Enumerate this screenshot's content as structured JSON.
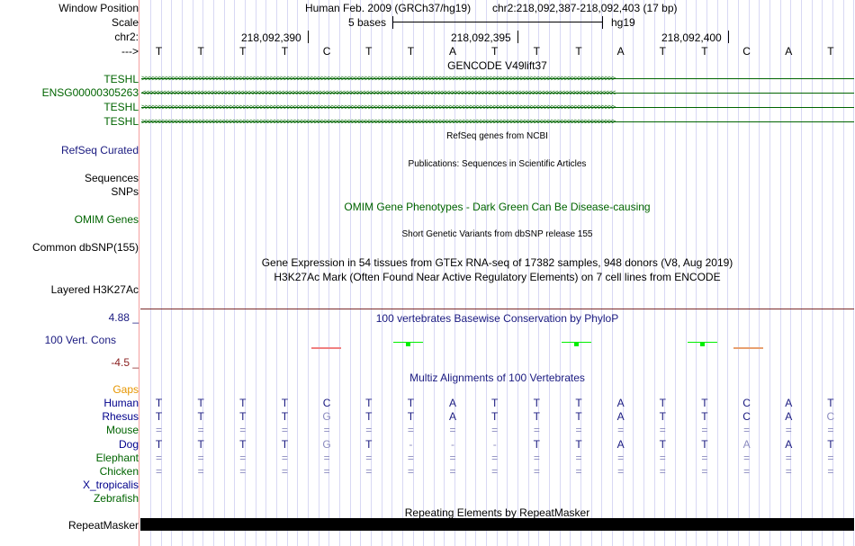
{
  "labels": {
    "window_position": "Window Position",
    "scale": "Scale",
    "chr": "chr2:",
    "strand": "--->",
    "teshl": "TESHL",
    "ensg": "ENSG00000305263",
    "refseq": "RefSeq Curated",
    "sequences": "Sequences",
    "snps": "SNPs",
    "omim": "OMIM Genes",
    "dbsnp": "Common dbSNP(155)",
    "h3k27ac": "Layered H3K27Ac",
    "cons_max": "4.88 _",
    "cons_label": "100 Vert. Cons",
    "cons_min": "-4.5 _",
    "gaps": "Gaps",
    "repeatmasker": "RepeatMasker"
  },
  "header": {
    "assembly": "Human Feb. 2009 (GRCh37/hg19)",
    "position": "chr2:218,092,387-218,092,403 (17 bp)",
    "scale_text": "5 bases",
    "scale_db": "hg19",
    "coord1": "218,092,390",
    "coord2": "218,092,395",
    "coord3": "218,092,400"
  },
  "track_titles": {
    "gencode": "GENCODE V49lift37",
    "refseq": "RefSeq genes from NCBI",
    "publications": "Publications: Sequences in Scientific Articles",
    "omim": "OMIM Gene Phenotypes - Dark Green Can Be Disease-causing",
    "dbsnp": "Short Genetic Variants from dbSNP release 155",
    "gtex": "Gene Expression in 54 tissues from GTEx RNA-seq of 17382 samples, 948 donors (V8, Aug 2019)",
    "h3k27ac": "H3K27Ac Mark (Often Found Near Active Regulatory Elements) on 7 cell lines from ENCODE",
    "phylop": "100 vertebrates Basewise Conservation by PhyloP",
    "multiz": "Multiz Alignments of 100 Vertebrates",
    "repeatmasker": "Repeating Elements by RepeatMasker"
  },
  "sequence": [
    "T",
    "T",
    "T",
    "T",
    "C",
    "T",
    "T",
    "A",
    "T",
    "T",
    "T",
    "A",
    "T",
    "T",
    "C",
    "A",
    "T"
  ],
  "alignment": [
    {
      "species": "Human",
      "bases": [
        "T",
        "T",
        "T",
        "T",
        "C",
        "T",
        "T",
        "A",
        "T",
        "T",
        "T",
        "A",
        "T",
        "T",
        "C",
        "A",
        "T"
      ]
    },
    {
      "species": "Rhesus",
      "bases": [
        "T",
        "T",
        "T",
        "T",
        "G",
        "T",
        "T",
        "A",
        "T",
        "T",
        "T",
        "A",
        "T",
        "T",
        "C",
        "A",
        "C"
      ]
    },
    {
      "species": "Mouse",
      "bases": [
        "=",
        "=",
        "=",
        "=",
        "=",
        "=",
        "=",
        "=",
        "=",
        "=",
        "=",
        "=",
        "=",
        "=",
        "=",
        "=",
        "="
      ]
    },
    {
      "species": "Dog",
      "bases": [
        "T",
        "T",
        "T",
        "T",
        "G",
        "T",
        "-",
        "-",
        "-",
        "T",
        "T",
        "A",
        "T",
        "T",
        "A",
        "A",
        "T"
      ]
    },
    {
      "species": "Elephant",
      "bases": [
        "=",
        "=",
        "=",
        "=",
        "=",
        "=",
        "=",
        "=",
        "=",
        "=",
        "=",
        "=",
        "=",
        "=",
        "=",
        "=",
        "="
      ]
    },
    {
      "species": "Chicken",
      "bases": [
        "=",
        "=",
        "=",
        "=",
        "=",
        "=",
        "=",
        "=",
        "=",
        "=",
        "=",
        "=",
        "=",
        "=",
        "=",
        "=",
        "="
      ]
    },
    {
      "species": "X_tropicalis",
      "bases": []
    },
    {
      "species": "Zebrafish",
      "bases": []
    }
  ],
  "colors": {
    "gene": "#006400",
    "alignment": "#1a1a80",
    "mismatch": "#8c8cc0",
    "conserved": "#00ee00",
    "gaps": "#e69500"
  }
}
